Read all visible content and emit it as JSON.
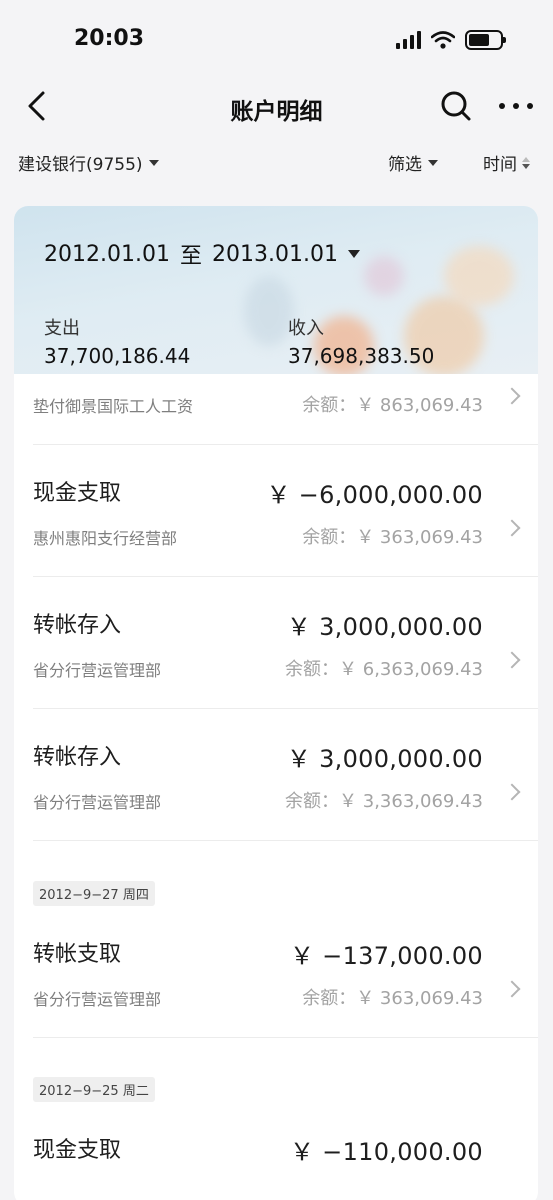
{
  "status_bar": {
    "time": "20:03"
  },
  "nav": {
    "title": "账户明细"
  },
  "filters": {
    "account": "建设银行(9755)",
    "filter_label": "筛选",
    "time_label": "时间"
  },
  "summary": {
    "date_start": "2012.01.01",
    "date_separator": "至",
    "date_end": "2013.01.01",
    "expense_label": "支出",
    "expense_value": "37,700,186.44",
    "income_label": "收入",
    "income_value": "37,698,383.50"
  },
  "transactions": [
    {
      "title": "",
      "amount": "",
      "subtitle": "垫付御景国际工人工资",
      "balance": "余额：￥ 863,069.43"
    },
    {
      "title": "现金支取",
      "amount": "￥ −6,000,000.00",
      "subtitle": "惠州惠阳支行经营部",
      "balance": "余额：￥ 363,069.43"
    },
    {
      "title": "转帐存入",
      "amount": "￥ 3,000,000.00",
      "subtitle": "省分行营运管理部",
      "balance": "余额：￥ 6,363,069.43"
    },
    {
      "title": "转帐存入",
      "amount": "￥ 3,000,000.00",
      "subtitle": "省分行营运管理部",
      "balance": "余额：￥ 3,363,069.43"
    },
    {
      "title": "转帐支取",
      "amount": "￥ −137,000.00",
      "subtitle": "省分行营运管理部",
      "balance": "余额：￥ 363,069.43"
    },
    {
      "title": "现金支取",
      "amount": "￥ −110,000.00",
      "subtitle": "",
      "balance": ""
    }
  ],
  "date_groups": [
    {
      "label": "2012−9−27 周四"
    },
    {
      "label": "2012−9−25 周二"
    }
  ],
  "icons": {
    "back": "back-arrow-icon",
    "search": "search-icon",
    "more": "more-dots-icon",
    "chevron": "chevron-right-icon"
  },
  "colors": {
    "background": "#f4f4f6",
    "card": "#ffffff",
    "text_primary": "#1e1e1e",
    "text_secondary": "#7f7f7f",
    "text_muted": "#a3a3a3"
  }
}
